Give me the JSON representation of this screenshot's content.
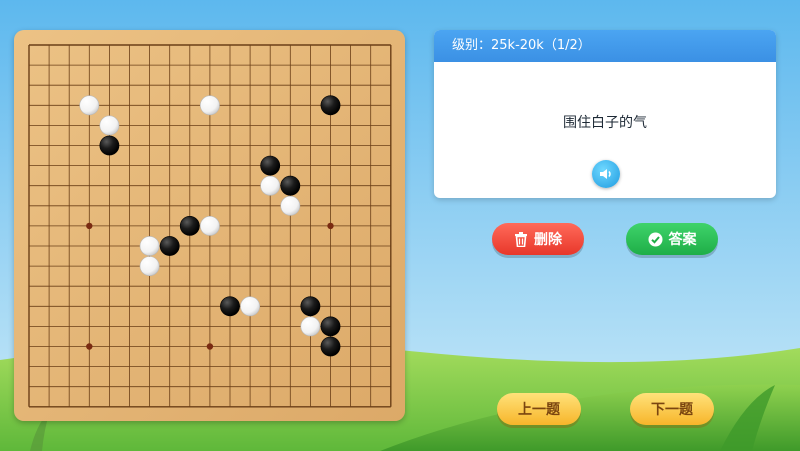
{
  "header": {
    "level_label": "级别：25k-20k（1/2）"
  },
  "prompt": {
    "text": "围住白子的气"
  },
  "buttons": {
    "delete_label": "删除",
    "answer_label": "答案",
    "prev_label": "上一题",
    "next_label": "下一题"
  },
  "board": {
    "size": 19,
    "star_points": [
      [
        3,
        9
      ],
      [
        15,
        9
      ],
      [
        3,
        15
      ],
      [
        9,
        15
      ],
      [
        15,
        15
      ]
    ],
    "stones": [
      {
        "color": "white",
        "col": 3,
        "row": 3
      },
      {
        "color": "white",
        "col": 9,
        "row": 3
      },
      {
        "color": "black",
        "col": 15,
        "row": 3
      },
      {
        "color": "white",
        "col": 4,
        "row": 4
      },
      {
        "color": "black",
        "col": 4,
        "row": 5
      },
      {
        "color": "black",
        "col": 12,
        "row": 6
      },
      {
        "color": "white",
        "col": 12,
        "row": 7
      },
      {
        "color": "black",
        "col": 13,
        "row": 7
      },
      {
        "color": "white",
        "col": 13,
        "row": 8
      },
      {
        "color": "black",
        "col": 8,
        "row": 9
      },
      {
        "color": "white",
        "col": 9,
        "row": 9
      },
      {
        "color": "white",
        "col": 6,
        "row": 10
      },
      {
        "color": "black",
        "col": 7,
        "row": 10
      },
      {
        "color": "white",
        "col": 6,
        "row": 11
      },
      {
        "color": "black",
        "col": 10,
        "row": 13
      },
      {
        "color": "white",
        "col": 11,
        "row": 13
      },
      {
        "color": "black",
        "col": 14,
        "row": 13
      },
      {
        "color": "white",
        "col": 14,
        "row": 14
      },
      {
        "color": "black",
        "col": 15,
        "row": 14
      },
      {
        "color": "black",
        "col": 15,
        "row": 15
      }
    ]
  },
  "colors": {
    "board_wood": "#e6b877",
    "grid_line": "#6b3f17",
    "sky": "#6fc3f0",
    "grass": "#8fd14f",
    "accent_blue": "#3b90e4",
    "delete_red": "#e8372a",
    "answer_green": "#1fae47",
    "nav_yellow": "#f7b52a"
  },
  "icons": {
    "sound": "speaker-icon",
    "delete": "trash-icon",
    "answer": "check-circle-icon"
  }
}
